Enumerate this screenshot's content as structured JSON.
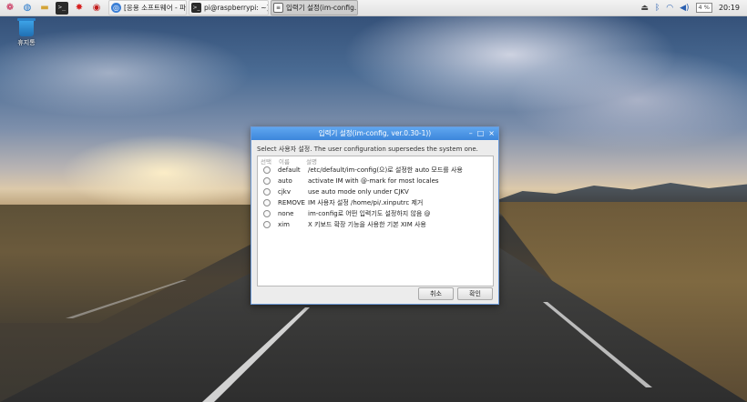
{
  "taskbar": {
    "launchers": [
      "raspberry-menu",
      "web-browser",
      "file-manager",
      "terminal",
      "mathematica",
      "wolfram"
    ],
    "tasks": [
      {
        "label": "[응용 소프트웨어 - 파...",
        "icon": "chromium-icon",
        "active": false
      },
      {
        "label": "pi@raspberrypi: ~]",
        "icon": "terminal-icon",
        "active": false
      },
      {
        "label": "입력기 설정(im-config...",
        "icon": "window-icon",
        "active": true
      }
    ],
    "tray": {
      "volume_label": "4 %",
      "clock": "20:19"
    }
  },
  "desktop": {
    "trash_label": "휴지통"
  },
  "dialog": {
    "title": "입력기 설정(im-config, ver.0.30-1))",
    "instruction": "Select 사용자 설정. The user configuration supersedes the system one.",
    "columns": [
      "선택",
      "이름",
      "설명"
    ],
    "rows": [
      {
        "name": "default",
        "desc": "/etc/default/im-config(으)로 설정한 auto 모드를 사용"
      },
      {
        "name": "auto",
        "desc": "activate IM with @-mark for most locales"
      },
      {
        "name": "cjkv",
        "desc": "use auto mode only under CJKV"
      },
      {
        "name": "REMOVE",
        "desc": "IM 사용자 설정 /home/pi/.xinputrc 제거"
      },
      {
        "name": "none",
        "desc": "im-config로 어떤 입력기도 설정하지 않음 @"
      },
      {
        "name": "xim",
        "desc": "X 키보드 확장 기능을 사용한 기본 XIM 사용"
      }
    ],
    "cancel_label": "취소",
    "ok_label": "확인"
  }
}
